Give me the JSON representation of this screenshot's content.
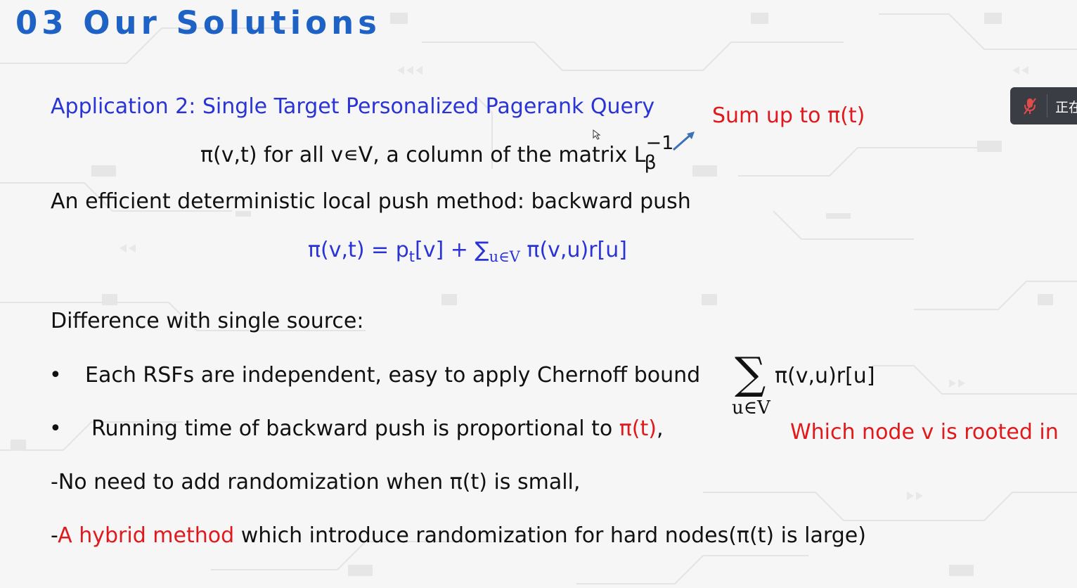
{
  "slide": {
    "title": "03 Our Solutions",
    "app_heading": "Application 2: Single Target Personalized Pagerank Query",
    "pi_line": "π(v,t) for all v∊V, a column of the matrix L",
    "pi_line_sub": "β",
    "pi_line_sup": "−1",
    "sum_note": "Sum up to π(t)",
    "efficient_line": "An efficient deterministic local push method: backward push",
    "formula_lhs": "π(v,t) = p",
    "formula_p_sub": "t",
    "formula_mid": "[v] + ∑",
    "formula_sum_sub": "u∈V",
    "formula_rhs": " π(v,u)r[u]",
    "difference_line": "Difference with single source:",
    "bullet1": "Each RSFs are independent, easy to apply Chernoff bound",
    "bullet2_prefix": "Running time of backward push is proportional to ",
    "bullet2_red": "π(t)",
    "bullet2_suffix": ",",
    "sum_formula_symbol": "∑",
    "sum_formula_sub": "u∈V",
    "sum_formula_term": "π(v,u)r[u]",
    "which_node_note": "Which node v is rooted in",
    "no_need_line": "-No need to add randomization when π(t) is small,",
    "hybrid_dash": "-",
    "hybrid_red": "A hybrid method",
    "hybrid_rest": " which introduce randomization for hard nodes(π(t) is large)",
    "bullet_char": "•"
  },
  "meeting_toolbar": {
    "icon": "muted-microphone-icon",
    "label": "正在"
  },
  "colors": {
    "title": "#1d62c4",
    "heading_blue": "#2a33d6",
    "red": "#e0191c",
    "arrow": "#3c73b7"
  }
}
